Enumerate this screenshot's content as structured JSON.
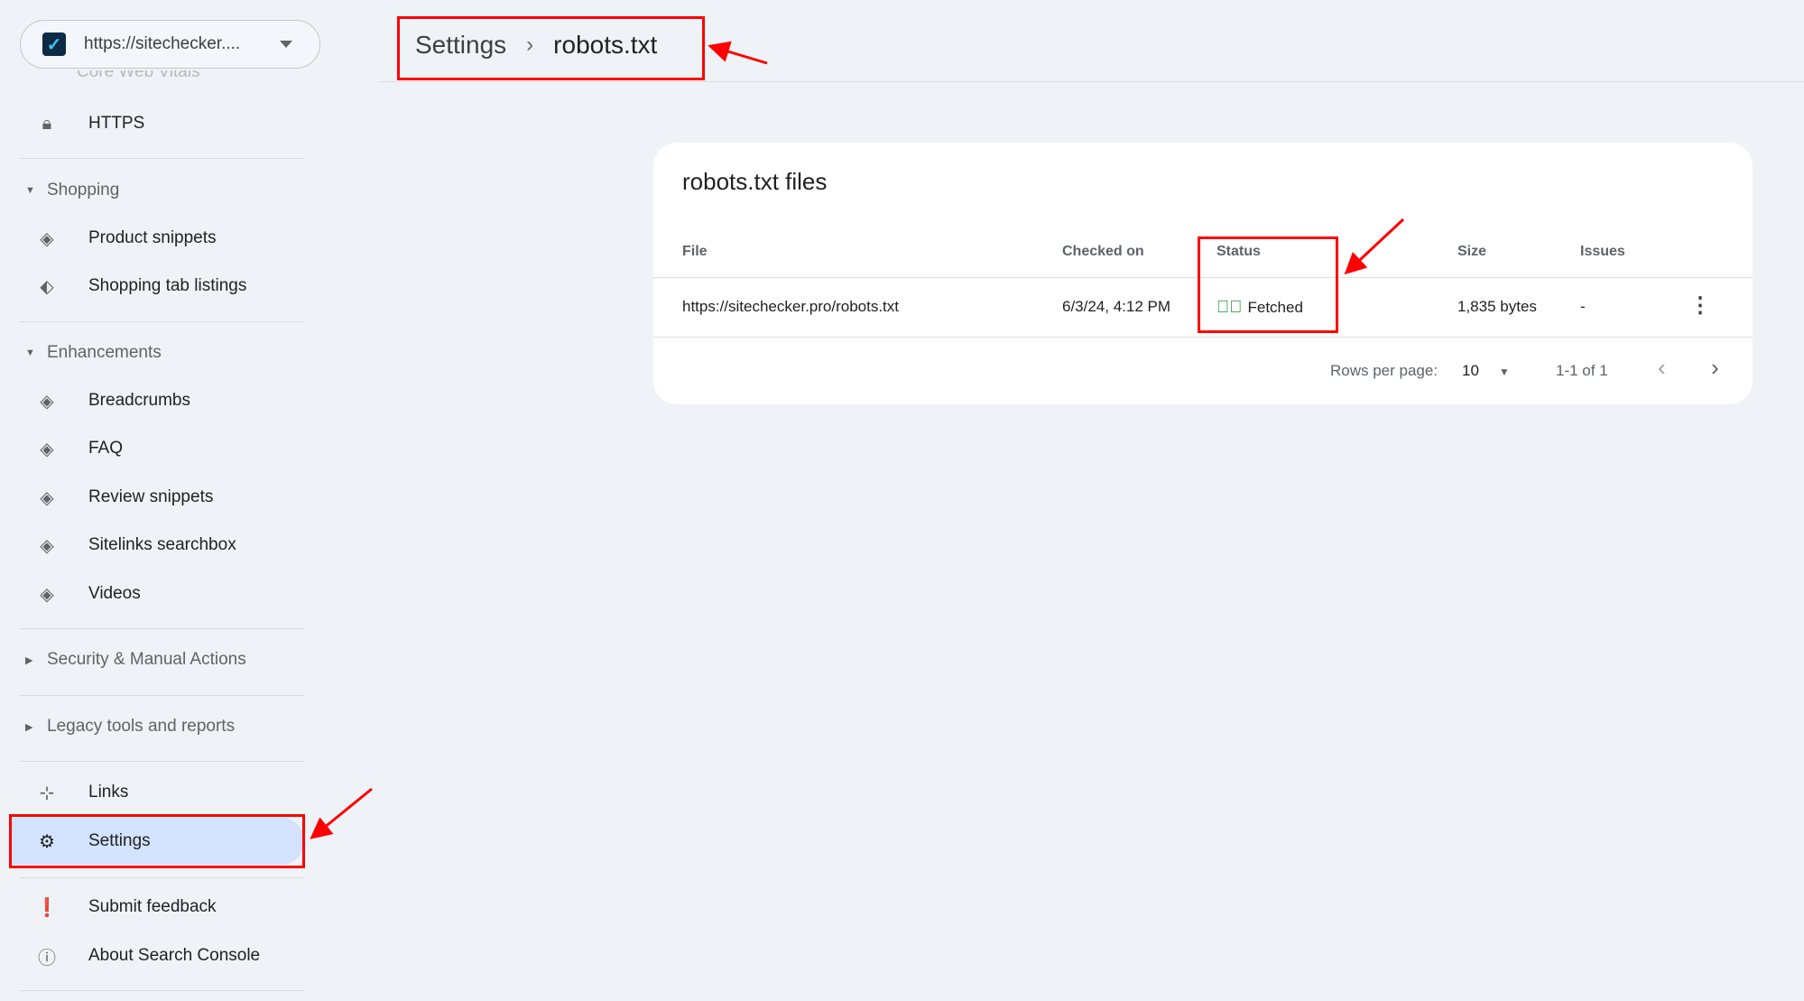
{
  "site_selector": {
    "url": "https://sitechecker....",
    "icon": "site-check-logo"
  },
  "breadcrumb": {
    "parent": "Settings",
    "current": "robots.txt",
    "separator": "›"
  },
  "sidebar": {
    "faded_item": "Core Web Vitals",
    "https": "HTTPS",
    "shopping": {
      "label": "Shopping",
      "items": [
        "Product snippets",
        "Shopping tab listings"
      ]
    },
    "enhancements": {
      "label": "Enhancements",
      "items": [
        "Breadcrumbs",
        "FAQ",
        "Review snippets",
        "Sitelinks searchbox",
        "Videos"
      ]
    },
    "security": "Security & Manual Actions",
    "legacy": "Legacy tools and reports",
    "links": "Links",
    "settings": "Settings",
    "feedback": "Submit feedback",
    "about": "About Search Console"
  },
  "card": {
    "title": "robots.txt files",
    "columns": [
      "File",
      "Checked on",
      "Status",
      "Size",
      "Issues"
    ],
    "rows": [
      {
        "file": "https://sitechecker.pro/robots.txt",
        "checked_on": "6/3/24, 4:12 PM",
        "status": "Fetched",
        "size": "1,835 bytes",
        "issues": "-"
      }
    ],
    "footer": {
      "rows_per_page_label": "Rows per page:",
      "rows_per_page": "10",
      "range": "1-1 of 1"
    }
  },
  "colors": {
    "selected": "#d3e3fd",
    "annotation": "#ff0000",
    "status_ok": "#1e8e3e"
  }
}
